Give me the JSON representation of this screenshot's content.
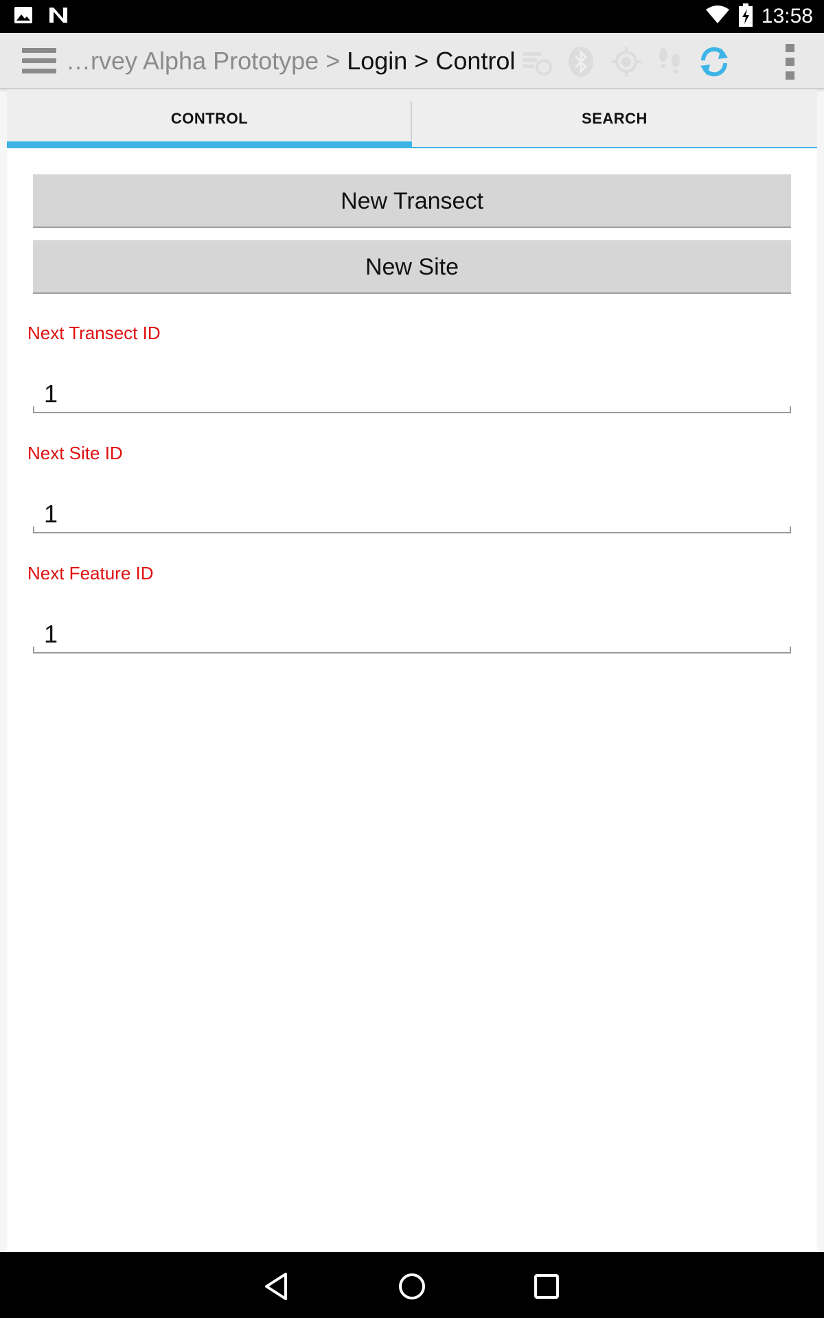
{
  "status_bar": {
    "time": "13:58",
    "left_icons": [
      "image-icon",
      "n-logo-icon"
    ],
    "right_icons": [
      "wifi-icon",
      "battery-charging-icon"
    ]
  },
  "action_bar": {
    "breadcrumb_muted": "…rvey Alpha Prototype > ",
    "breadcrumb_current": "Login > Control",
    "icons": [
      "drawer-menu-icon",
      "sync-list-icon",
      "bluetooth-icon",
      "gps-icon",
      "footsteps-icon",
      "refresh-icon",
      "overflow-menu-icon"
    ]
  },
  "tabs": [
    {
      "label": "CONTROL",
      "active": true
    },
    {
      "label": "SEARCH",
      "active": false
    }
  ],
  "buttons": {
    "new_transect": "New Transect",
    "new_site": "New Site"
  },
  "fields": [
    {
      "label": "Next Transect ID",
      "value": "1"
    },
    {
      "label": "Next Site ID",
      "value": "1"
    },
    {
      "label": "Next Feature ID",
      "value": "1"
    }
  ],
  "colors": {
    "accent": "#3db4e6",
    "label_red": "#e01010",
    "button_gray": "#d6d6d6"
  },
  "nav_bar": {
    "icons": [
      "back-icon",
      "home-icon",
      "recents-icon"
    ]
  }
}
